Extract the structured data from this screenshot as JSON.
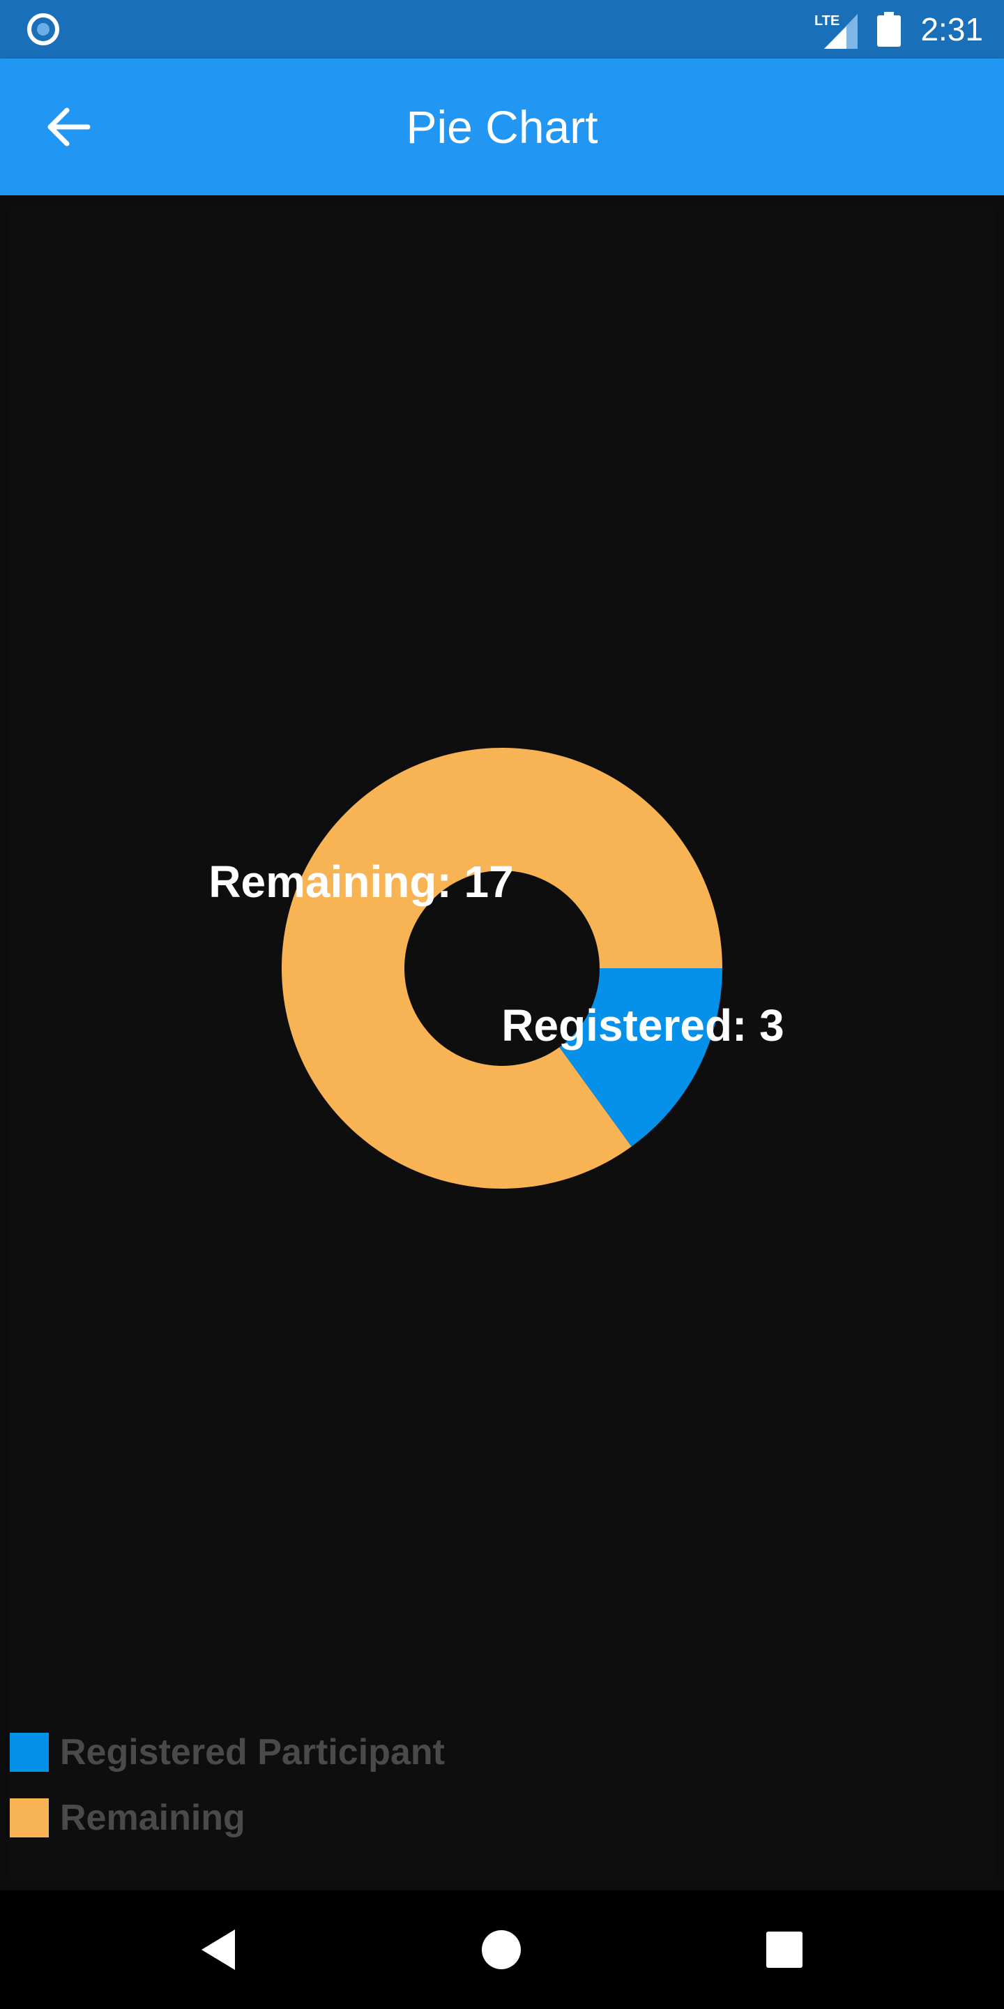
{
  "status_bar": {
    "time": "2:31",
    "network": "LTE",
    "icons": [
      "app-notification-icon",
      "signal-icon",
      "battery-icon"
    ],
    "color": "#1a6fb9"
  },
  "app_bar": {
    "title": "Pie Chart",
    "back_icon": "back-arrow-icon",
    "color": "#2196f3"
  },
  "chart_data": {
    "type": "pie",
    "donut": true,
    "slices": [
      {
        "name": "Registered",
        "value": 3,
        "label": "Registered: 3",
        "color": "#0591ea"
      },
      {
        "name": "Remaining",
        "value": 17,
        "label": "Remaining: 17",
        "color": "#f8b454"
      }
    ],
    "legend": [
      {
        "label": "Registered Participant",
        "color": "#0591ea"
      },
      {
        "label": "Remaining",
        "color": "#f8b454"
      }
    ],
    "legend_position": "bottom-left"
  },
  "nav_bar": {
    "icons": [
      "back-triangle-icon",
      "home-circle-icon",
      "recents-square-icon"
    ]
  }
}
